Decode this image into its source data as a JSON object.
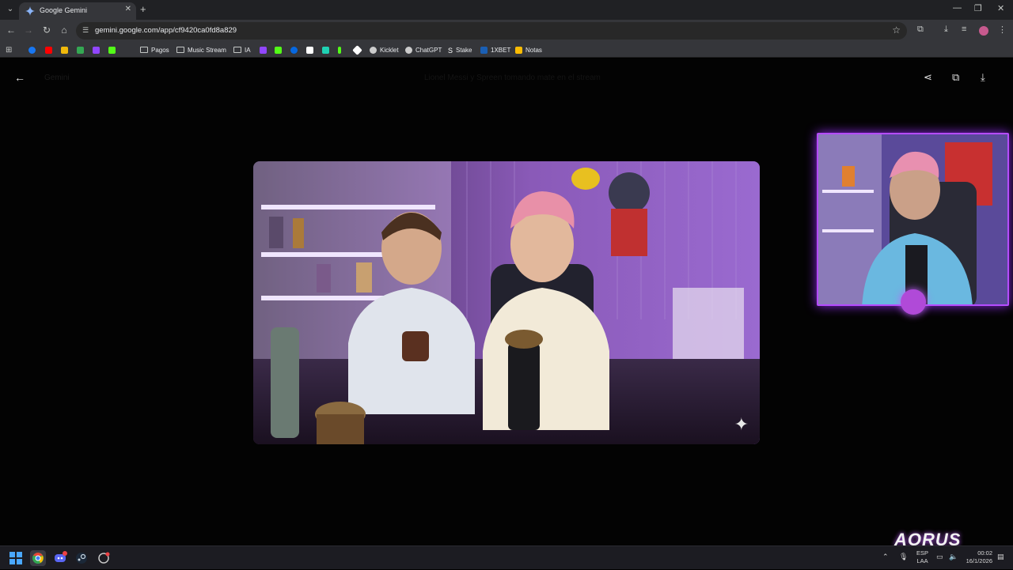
{
  "browser": {
    "tab_title": "Google Gemini",
    "url": "gemini.google.com/app/cf9420ca0fd8a829",
    "bookmarks": [
      {
        "label": "",
        "color": "#1877f2"
      },
      {
        "label": "",
        "color": "#ff0000"
      },
      {
        "label": "",
        "color": "#f0b90b"
      },
      {
        "label": "",
        "color": "#34a853"
      },
      {
        "label": "",
        "color": "#9146ff"
      },
      {
        "label": "",
        "color": "#53fc18"
      },
      {
        "label": "Pagos",
        "type": "folder"
      },
      {
        "label": "Music Stream",
        "type": "folder"
      },
      {
        "label": "IA",
        "type": "folder"
      },
      {
        "label": "",
        "color": "#9146ff"
      },
      {
        "label": "",
        "color": "#53fc18"
      },
      {
        "label": "",
        "color": "#0668e1"
      },
      {
        "label": "",
        "color": "#ffffff"
      },
      {
        "label": "",
        "color": "#1fd1b3"
      },
      {
        "label": "",
        "color": "#53fc18"
      },
      {
        "label": "",
        "color": "#ffffff"
      },
      {
        "label": "Kicklet",
        "color": "#cccccc"
      },
      {
        "label": "ChatGPT",
        "color": "#cccccc"
      },
      {
        "label": "Stake",
        "color": "#cccccc"
      },
      {
        "label": "1XBET",
        "color": "#1a5fb4"
      },
      {
        "label": "Notas",
        "color": "#fbbc04"
      }
    ]
  },
  "viewer": {
    "title": "Gemini",
    "prompt": "Lionel Messi y Spreen tomando mate en el stream"
  },
  "taskbar": {
    "language": "ESP",
    "layout": "LAA",
    "time": "00:02",
    "date": "16/1/2026",
    "brand": "AORUS"
  }
}
